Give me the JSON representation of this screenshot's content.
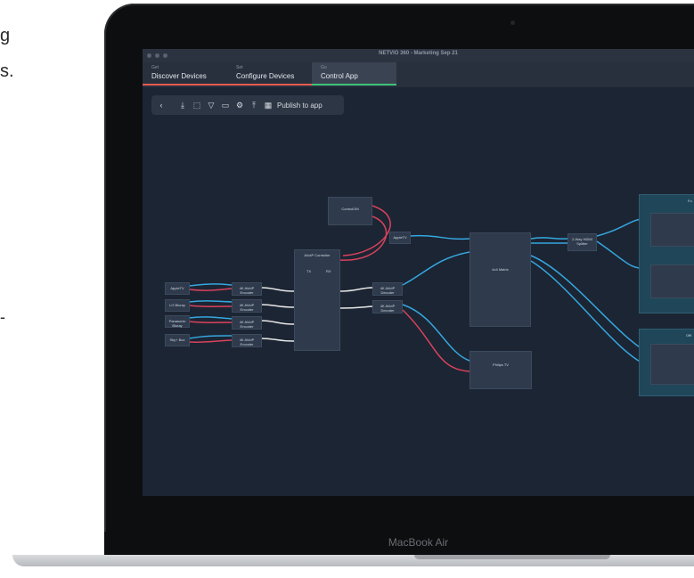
{
  "marketing_text": {
    "line1": "g",
    "line2": "s.",
    "line3": "-"
  },
  "window": {
    "title": "NETVIO 360 - Marketing Sep 21"
  },
  "tabs": [
    {
      "kicker": "Get",
      "label": "Discover Devices"
    },
    {
      "kicker": "Set",
      "label": "Configure Devices"
    },
    {
      "kicker": "Go",
      "label": "Control App"
    }
  ],
  "toolbar": {
    "publish_label": "Publish to app"
  },
  "diagram": {
    "sources": [
      "AppleTV",
      "LG Bluray",
      "Panasonic Bluray",
      "Sky+ Box"
    ],
    "encoders": [
      "4K AVoIP Encoder",
      "4K AVoIP Encoder",
      "4K AVoIP Encoder",
      "4K AVoIP Encoder"
    ],
    "controller": {
      "title": "AVoIP Controller",
      "tx": "TX",
      "rx": "RX"
    },
    "control": "ControlOM",
    "appletv": "AppleTV",
    "decoders": [
      "4K AVoIP Decoder",
      "4K AVoIP Decoder"
    ],
    "matrix": "4x4 Matrix",
    "splitter": "2-Way HDMI Splitter",
    "tv": "Philips TV",
    "groups": [
      "Fo",
      "Offi"
    ]
  },
  "device_brand": "MacBook Air",
  "colors": {
    "accent_red": "#e85a4f",
    "accent_green": "#3ec37a",
    "wire_blue": "#35a7e0",
    "wire_red": "#d9425d",
    "wire_white": "#e8e8e8"
  }
}
